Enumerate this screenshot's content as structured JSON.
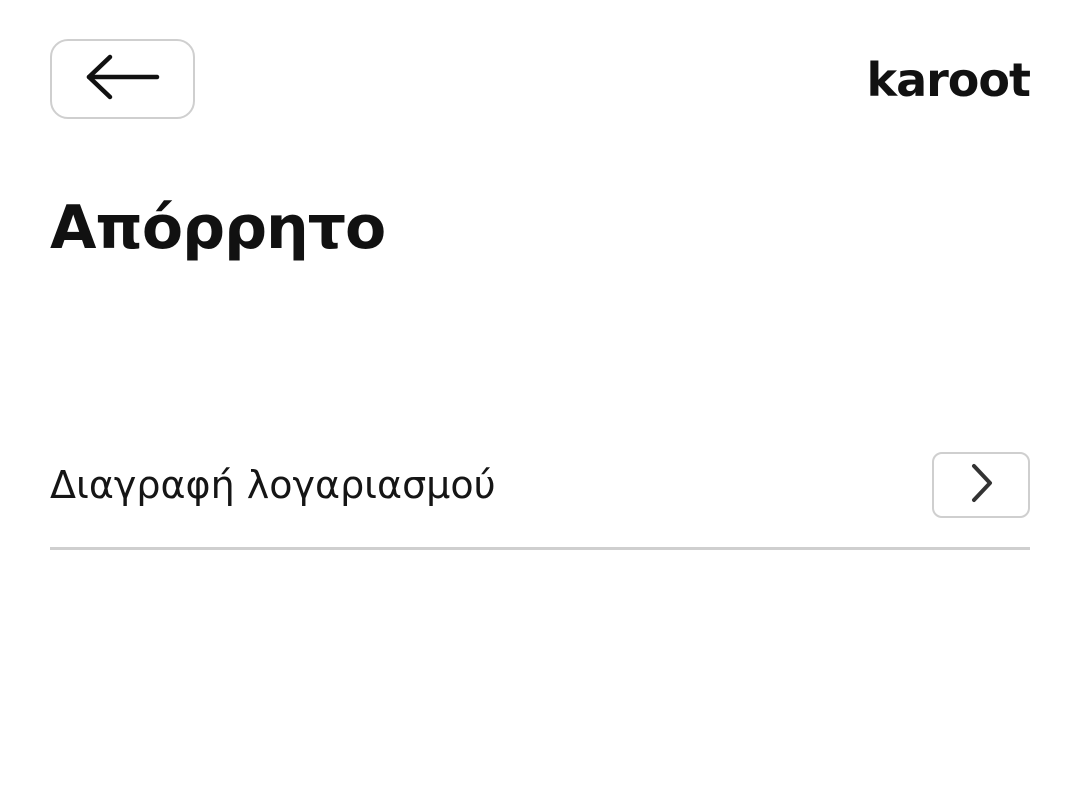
{
  "header": {
    "back_icon": "arrow-left-icon",
    "logo_text": "karoot"
  },
  "page": {
    "title": "Απόρρητο"
  },
  "settings": {
    "items": [
      {
        "label": "Διαγραφή λογαριασμού",
        "icon": "chevron-right-icon"
      }
    ]
  },
  "colors": {
    "text": "#111111",
    "border": "#cfcfcf",
    "background": "#ffffff"
  }
}
